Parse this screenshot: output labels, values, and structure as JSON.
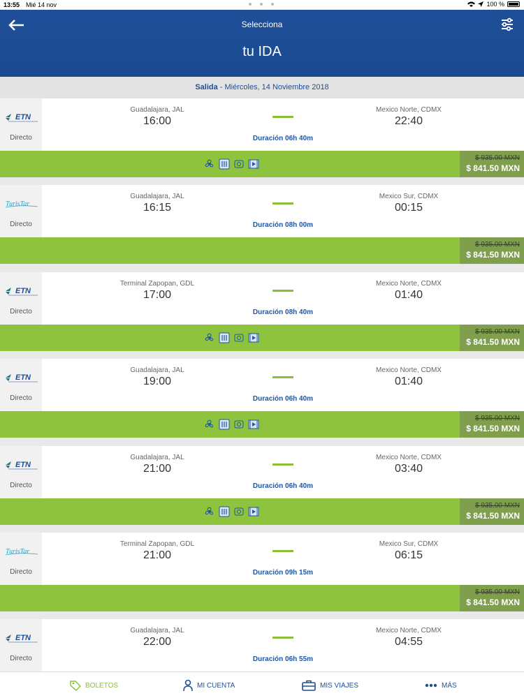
{
  "status": {
    "time": "13:55",
    "date": "Mié 14 nov",
    "battery": "100 %"
  },
  "header": {
    "subtitle": "Selecciona",
    "title": "tu IDA"
  },
  "dateband": {
    "label": "Salida",
    "text": " - Miércoles, 14 Noviembre 2018"
  },
  "trips": [
    {
      "carrier": "ETN",
      "type": "Directo",
      "origin": "Guadalajara, JAL",
      "depart": "16:00",
      "dest": "Mexico Norte, CDMX",
      "arrive": "22:40",
      "duration": "Duración 06h 40m",
      "old_price": "$ 935.00 MXN",
      "price": "$ 841.50 MXN",
      "amenities": true
    },
    {
      "carrier": "Turistar",
      "type": "Directo",
      "origin": "Guadalajara, JAL",
      "depart": "16:15",
      "dest": "Mexico Sur, CDMX",
      "arrive": "00:15",
      "duration": "Duración 08h 00m",
      "old_price": "$ 935.00 MXN",
      "price": "$ 841.50 MXN",
      "amenities": false
    },
    {
      "carrier": "ETN",
      "type": "Directo",
      "origin": "Terminal Zapopan, GDL",
      "depart": "17:00",
      "dest": "Mexico Norte, CDMX",
      "arrive": "01:40",
      "duration": "Duración 08h 40m",
      "old_price": "$ 935.00 MXN",
      "price": "$ 841.50 MXN",
      "amenities": true
    },
    {
      "carrier": "ETN",
      "type": "Directo",
      "origin": "Guadalajara, JAL",
      "depart": "19:00",
      "dest": "Mexico Norte, CDMX",
      "arrive": "01:40",
      "duration": "Duración 06h 40m",
      "old_price": "$ 935.00 MXN",
      "price": "$ 841.50 MXN",
      "amenities": true
    },
    {
      "carrier": "ETN",
      "type": "Directo",
      "origin": "Guadalajara, JAL",
      "depart": "21:00",
      "dest": "Mexico Norte, CDMX",
      "arrive": "03:40",
      "duration": "Duración 06h 40m",
      "old_price": "$ 935.00 MXN",
      "price": "$ 841.50 MXN",
      "amenities": true
    },
    {
      "carrier": "Turistar",
      "type": "Directo",
      "origin": "Terminal Zapopan, GDL",
      "depart": "21:00",
      "dest": "Mexico Sur, CDMX",
      "arrive": "06:15",
      "duration": "Duración 09h 15m",
      "old_price": "$ 935.00 MXN",
      "price": "$ 841.50 MXN",
      "amenities": false
    },
    {
      "carrier": "ETN",
      "type": "Directo",
      "origin": "Guadalajara, JAL",
      "depart": "22:00",
      "dest": "Mexico Norte, CDMX",
      "arrive": "04:55",
      "duration": "Duración 06h 55m",
      "old_price": "",
      "price": "",
      "amenities": false
    }
  ],
  "nav": {
    "boletos": "BOLETOS",
    "cuenta": "MI CUENTA",
    "viajes": "MIS VIAJES",
    "mas": "MÁS"
  },
  "colors": {
    "header": "#1e4f98",
    "accent_green": "#8ec43d",
    "price_box": "#7f9f4c",
    "link_blue": "#1f56a5"
  }
}
